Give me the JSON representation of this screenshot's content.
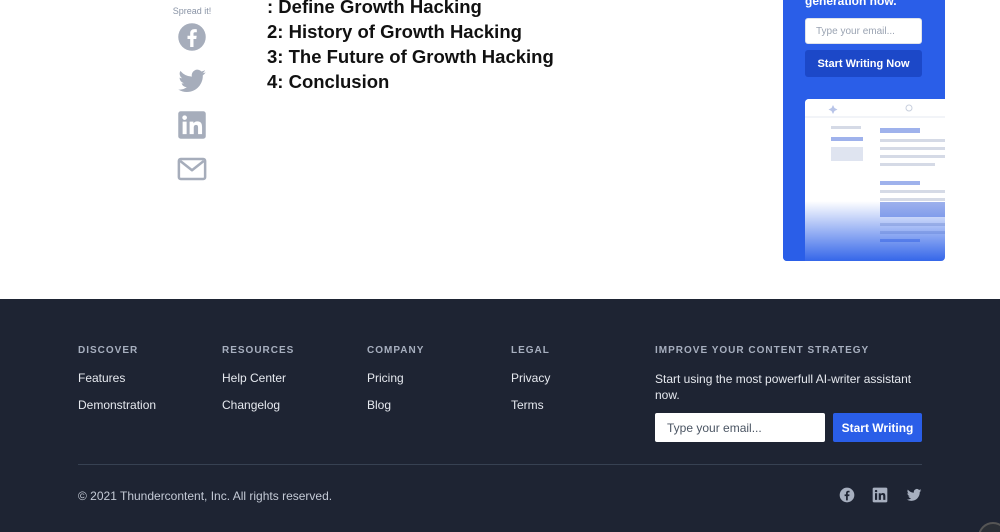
{
  "share": {
    "label": "Spread it!",
    "icons": [
      "facebook-icon",
      "twitter-icon",
      "linkedin-icon",
      "email-icon"
    ],
    "icon_color": "#a6adbb"
  },
  "toc": {
    "items": [
      ": Define Growth Hacking",
      "2: History of Growth Hacking",
      "3: The Future of Growth Hacking",
      "4: Conclusion"
    ]
  },
  "promo": {
    "title_partial": "generation now.",
    "email_placeholder": "Type your email...",
    "button_label": "Start Writing Now",
    "bg_color": "#2a5ee8"
  },
  "footer": {
    "bg_color": "#1e2433",
    "discover": {
      "heading": "DISCOVER",
      "links": [
        "Features",
        "Demonstration"
      ]
    },
    "resources": {
      "heading": "RESOURCES",
      "links": [
        "Help Center",
        "Changelog"
      ]
    },
    "company": {
      "heading": "COMPANY",
      "links": [
        "Pricing",
        "Blog"
      ]
    },
    "legal": {
      "heading": "LEGAL",
      "links": [
        "Privacy",
        "Terms"
      ]
    },
    "strategy": {
      "heading": "IMPROVE YOUR CONTENT STRATEGY",
      "text": "Start using the most powerfull AI-writer assistant now.",
      "email_placeholder": "Type your email...",
      "button_label": "Start Writing"
    },
    "copyright": "© 2021 Thundercontent, Inc. All rights reserved.",
    "social_icons": [
      "facebook-icon",
      "linkedin-icon",
      "twitter-icon"
    ],
    "accent_color": "#2a5ee8"
  }
}
